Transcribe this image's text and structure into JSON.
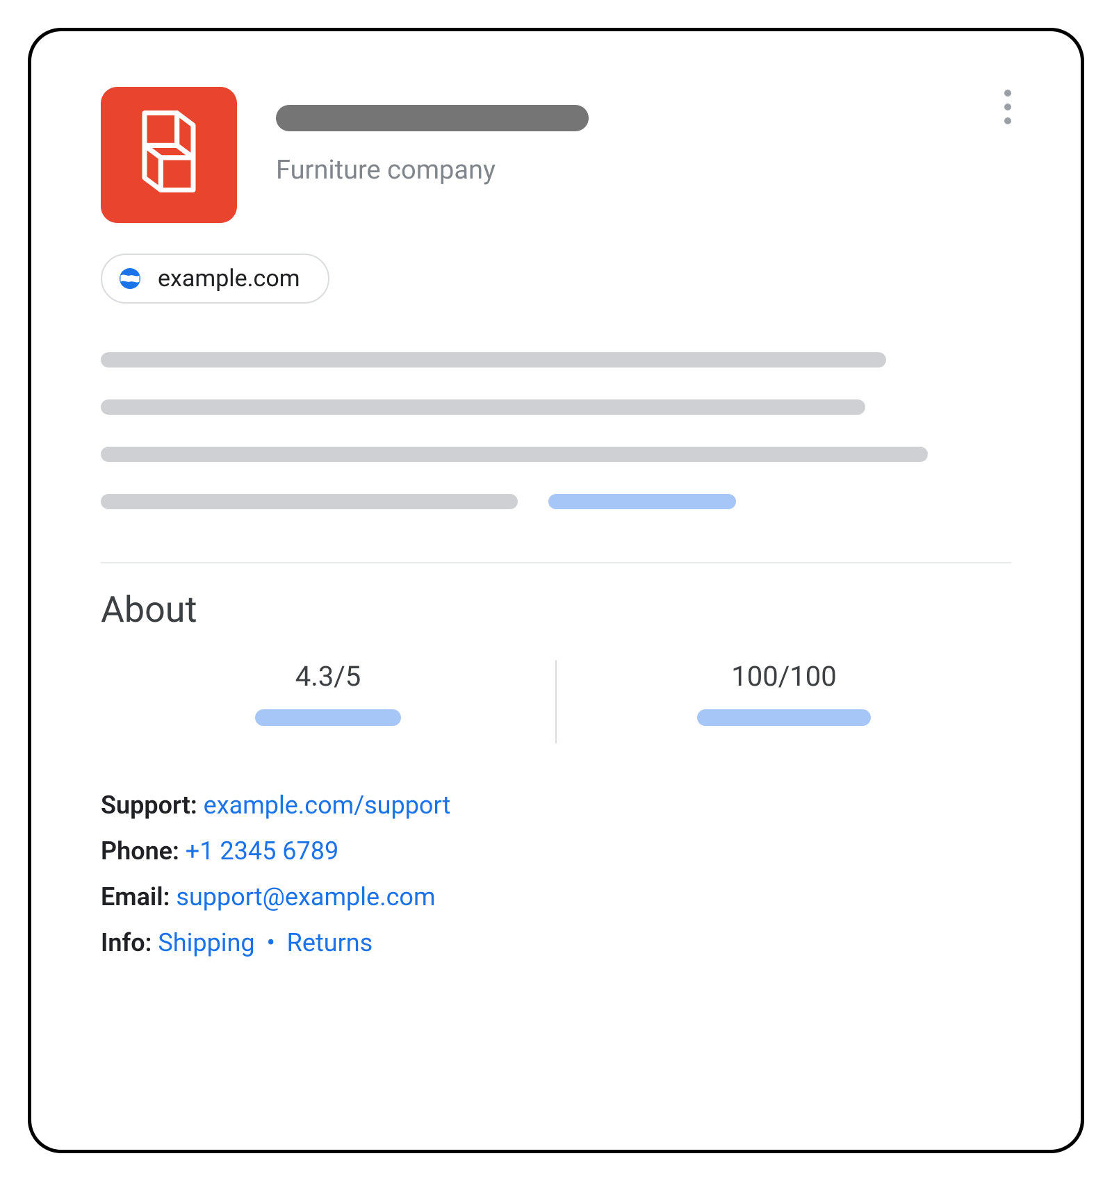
{
  "header": {
    "subtitle": "Furniture company",
    "website": "example.com"
  },
  "about": {
    "heading": "About",
    "rating": "4.3/5",
    "score": "100/100"
  },
  "contacts": {
    "support_label": "Support:",
    "support_link_text": "example.com/support",
    "phone_label": "Phone:",
    "phone_link_text": "+1 2345 6789",
    "email_label": "Email:",
    "email_link_text": "support@example.com",
    "info_label": "Info:",
    "info_shipping": "Shipping",
    "info_separator": "•",
    "info_returns": "Returns"
  }
}
